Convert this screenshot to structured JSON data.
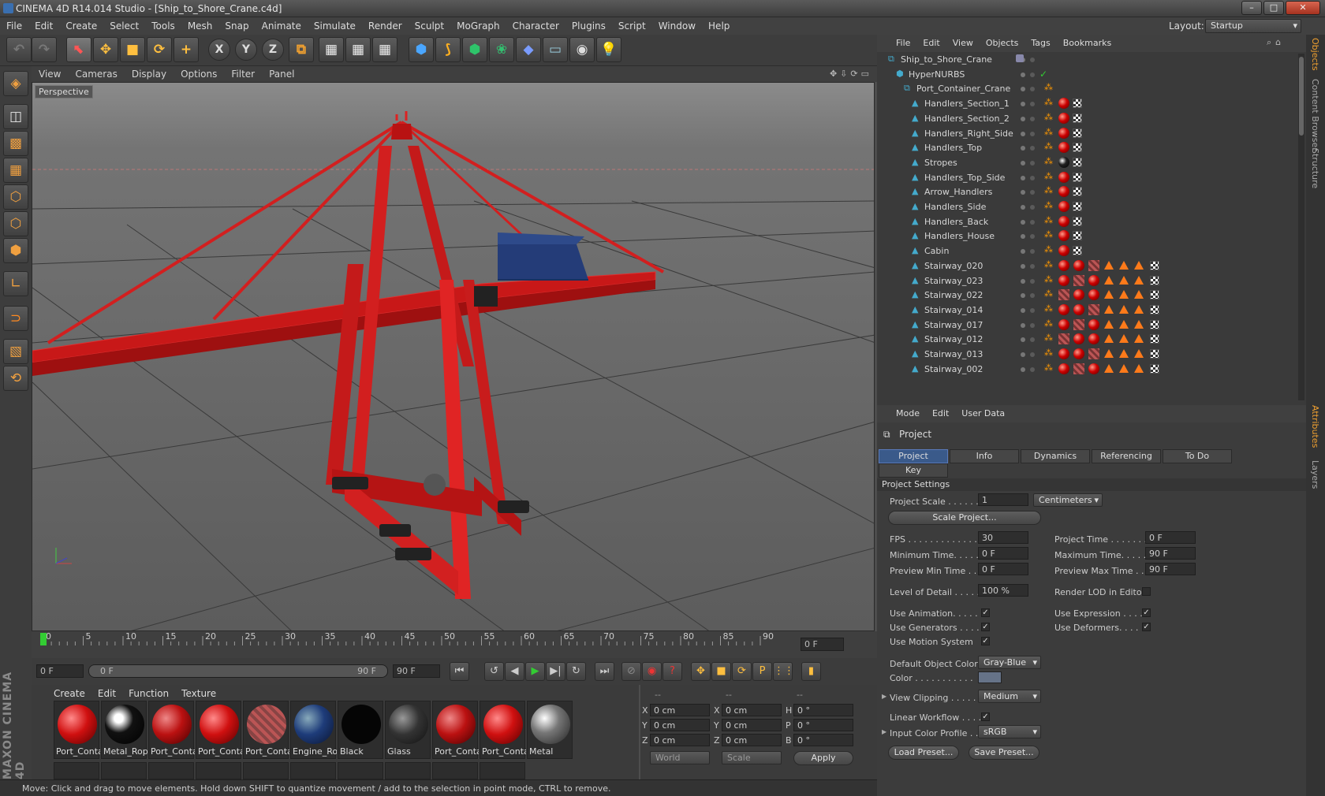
{
  "window": {
    "title": "CINEMA 4D R14.014 Studio - [Ship_to_Shore_Crane.c4d]",
    "min_label": "–",
    "max_label": "□",
    "close_label": "✕"
  },
  "menu": [
    "File",
    "Edit",
    "Create",
    "Select",
    "Tools",
    "Mesh",
    "Snap",
    "Animate",
    "Simulate",
    "Render",
    "Sculpt",
    "MoGraph",
    "Character",
    "Plugins",
    "Script",
    "Window",
    "Help"
  ],
  "layout": {
    "label": "Layout:",
    "value": "Startup"
  },
  "toolbar": {
    "icons": [
      "undo-icon",
      "redo-icon",
      "live-select-icon",
      "move-icon",
      "scale-icon",
      "rotate-icon",
      "add-icon",
      "x-axis-icon",
      "y-axis-icon",
      "z-axis-icon",
      "coordinate-system-icon",
      "render-view-icon",
      "render-picture-viewer-icon",
      "render-settings-icon",
      "cube-icon",
      "spline-pen-icon",
      "subdivision-icon",
      "cloner-icon",
      "deformer-icon",
      "floor-icon",
      "camera-icon",
      "light-icon"
    ],
    "x_label": "X",
    "y_label": "Y",
    "z_label": "Z"
  },
  "viewport": {
    "menu": [
      "View",
      "Cameras",
      "Display",
      "Options",
      "Filter",
      "Panel"
    ],
    "label": "Perspective"
  },
  "timeline": {
    "ticks": [
      "0",
      "5",
      "10",
      "15",
      "20",
      "25",
      "30",
      "35",
      "40",
      "45",
      "50",
      "55",
      "60",
      "65",
      "70",
      "75",
      "80",
      "85",
      "90"
    ],
    "current": "0 F"
  },
  "transport": {
    "start": "0 F",
    "range_start": "0 F",
    "range_end": "90 F",
    "end": "90 F"
  },
  "material_manager": {
    "menu": [
      "Create",
      "Edit",
      "Function",
      "Texture"
    ],
    "materials": [
      {
        "name": "Port_Conta",
        "style": "red"
      },
      {
        "name": "Metal_Rop",
        "style": "black-shiny"
      },
      {
        "name": "Port_Conta",
        "style": "red-rough"
      },
      {
        "name": "Port_Conta",
        "style": "red"
      },
      {
        "name": "Port_Conta",
        "style": "stripe"
      },
      {
        "name": "Engine_Ro",
        "style": "blue"
      },
      {
        "name": "Black",
        "style": "black"
      },
      {
        "name": "Glass",
        "style": "glass"
      },
      {
        "name": "Port_Conta",
        "style": "red-rough"
      },
      {
        "name": "Port_Conta",
        "style": "red"
      },
      {
        "name": "Metal",
        "style": "metal"
      }
    ]
  },
  "coordinates": {
    "headers": [
      "--",
      "--",
      "--"
    ],
    "rows": [
      {
        "a": "X",
        "av": "0 cm",
        "b": "X",
        "bv": "0 cm",
        "c": "H",
        "cv": "0 °"
      },
      {
        "a": "Y",
        "av": "0 cm",
        "b": "Y",
        "bv": "0 cm",
        "c": "P",
        "cv": "0 °"
      },
      {
        "a": "Z",
        "av": "0 cm",
        "b": "Z",
        "bv": "0 cm",
        "c": "B",
        "cv": "0 °"
      }
    ],
    "world": "World",
    "scale": "Scale",
    "apply": "Apply"
  },
  "status": "Move: Click and drag to move elements. Hold down SHIFT to quantize movement / add to the selection in point mode, CTRL to remove.",
  "object_manager": {
    "menu": [
      "File",
      "Edit",
      "View",
      "Objects",
      "Tags",
      "Bookmarks"
    ],
    "objects": [
      {
        "name": "Ship_to_Shore_Crane",
        "indent": 0,
        "tags": "layer"
      },
      {
        "name": "HyperNURBS",
        "indent": 1,
        "tags": "check"
      },
      {
        "name": "Port_Container_Crane",
        "indent": 2,
        "tags": "none"
      },
      {
        "name": "Handlers_Section_1",
        "indent": 3,
        "tags": "rc"
      },
      {
        "name": "Handlers_Section_2",
        "indent": 3,
        "tags": "rc"
      },
      {
        "name": "Handlers_Right_Side",
        "indent": 3,
        "tags": "rc"
      },
      {
        "name": "Handlers_Top",
        "indent": 3,
        "tags": "rc"
      },
      {
        "name": "Stropes",
        "indent": 3,
        "tags": "kc"
      },
      {
        "name": "Handlers_Top_Side",
        "indent": 3,
        "tags": "rc"
      },
      {
        "name": "Arrow_Handlers",
        "indent": 3,
        "tags": "rc"
      },
      {
        "name": "Handlers_Side",
        "indent": 3,
        "tags": "rc"
      },
      {
        "name": "Handlers_Back",
        "indent": 3,
        "tags": "rc"
      },
      {
        "name": "Handlers_House",
        "indent": 3,
        "tags": "rc"
      },
      {
        "name": "Cabin",
        "indent": 3,
        "tags": "rc"
      },
      {
        "name": "Stairway_020",
        "indent": 3,
        "tags": "stair"
      },
      {
        "name": "Stairway_023",
        "indent": 3,
        "tags": "stair"
      },
      {
        "name": "Stairway_022",
        "indent": 3,
        "tags": "stair"
      },
      {
        "name": "Stairway_014",
        "indent": 3,
        "tags": "stair"
      },
      {
        "name": "Stairway_017",
        "indent": 3,
        "tags": "stair"
      },
      {
        "name": "Stairway_012",
        "indent": 3,
        "tags": "stair"
      },
      {
        "name": "Stairway_013",
        "indent": 3,
        "tags": "stair"
      },
      {
        "name": "Stairway_002",
        "indent": 3,
        "tags": "stair"
      }
    ]
  },
  "attributes": {
    "menu": [
      "Mode",
      "Edit",
      "User Data"
    ],
    "title": "Project",
    "tabs": [
      "Project Settings",
      "Info",
      "Dynamics",
      "Referencing",
      "To Do"
    ],
    "tab2": "Key Interpolation",
    "section": "Project Settings",
    "scale_label": "Project Scale . . . . . .",
    "scale_value": "1",
    "scale_unit": "Centimeters",
    "scale_btn": "Scale Project...",
    "fps_label": "FPS . . . . . . . . . . . . . . .",
    "fps": "30",
    "ptime_label": "Project Time . . . . . . . .",
    "ptime": "0 F",
    "mintime_label": "Minimum Time. . . . . . .",
    "mintime": "0 F",
    "maxtime_label": "Maximum Time. . . . . . .",
    "maxtime": "90 F",
    "pmin_label": "Preview Min Time . . .",
    "pmin": "0 F",
    "pmax_label": "Preview Max Time . . .",
    "pmax": "90 F",
    "lod_label": "Level of Detail . . . . .",
    "lod": "100 %",
    "renderlod_label": "Render LOD in Editor",
    "useanim_label": "Use Animation. . . . . .",
    "useexpr_label": "Use Expression . . . . .",
    "usegen_label": "Use Generators . . . .",
    "usedef_label": "Use Deformers. . . . . .",
    "usemotion_label": "Use Motion System",
    "defcolor_label": "Default Object Color",
    "defcolor": "Gray-Blue",
    "color_label": "Color . . . . . . . . . . .",
    "clip_label": "View Clipping . . . . .",
    "clip": "Medium",
    "linear_label": "Linear Workflow . . . .",
    "profile_label": "Input Color Profile . .",
    "profile": "sRGB",
    "load_btn": "Load Preset...",
    "save_btn": "Save Preset...",
    "check": "✓"
  },
  "right_tabs": [
    "Objects",
    "Content Browser",
    "Structure",
    "Attributes",
    "Layers"
  ],
  "brand": "MAXON CINEMA 4D"
}
